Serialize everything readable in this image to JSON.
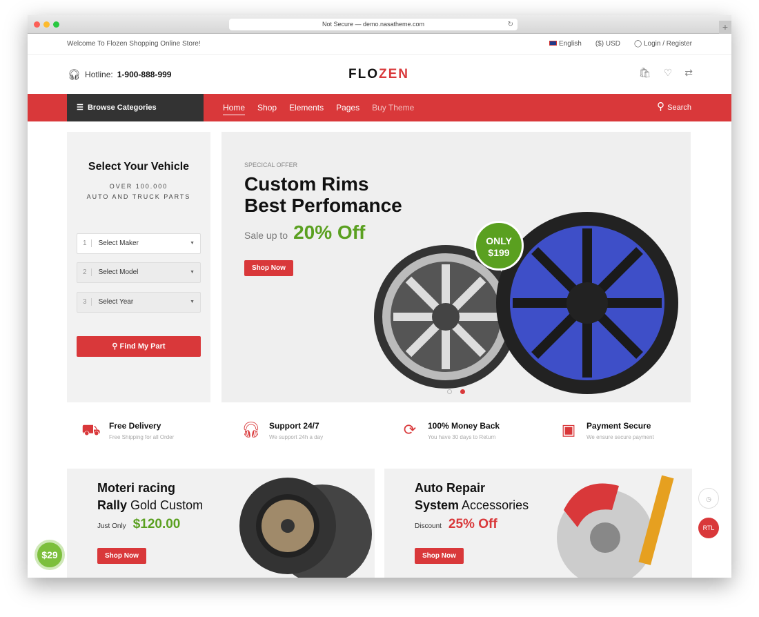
{
  "browser": {
    "url": "Not Secure — demo.nasatheme.com"
  },
  "topbar": {
    "welcome": "Welcome To Flozen Shopping Online Store!",
    "language": "English",
    "currency": "($) USD",
    "login": "Login / Register"
  },
  "header": {
    "hotline_label": "Hotline:",
    "hotline": "1-900-888-999",
    "logo_a": "FLO",
    "logo_b": "ZEN"
  },
  "nav": {
    "browse": "Browse Categories",
    "items": [
      "Home",
      "Shop",
      "Elements",
      "Pages",
      "Buy Theme"
    ],
    "search": "Search"
  },
  "vehicle": {
    "title": "Select Your Vehicle",
    "sub1": "OVER 100.000",
    "sub2": "AUTO AND TRUCK PARTS",
    "selects": [
      {
        "n": "1",
        "label": "Select Maker"
      },
      {
        "n": "2",
        "label": "Select Model"
      },
      {
        "n": "3",
        "label": "Select Year"
      }
    ],
    "button": "Find My Part"
  },
  "slider": {
    "tag": "SPECICAL OFFER",
    "title1": "Custom Rims",
    "title2": "Best Perfomance",
    "sale": "Sale up to",
    "off": "20% Off",
    "button": "Shop Now",
    "only": "ONLY",
    "price": "$199"
  },
  "features": [
    {
      "icon": "truck-icon",
      "title": "Free Delivery",
      "sub": "Free Shipping for all Order"
    },
    {
      "icon": "headset-icon",
      "title": "Support 24/7",
      "sub": "We support 24h a day"
    },
    {
      "icon": "refresh-icon",
      "title": "100% Money Back",
      "sub": "You have 30 days to Return"
    },
    {
      "icon": "payment-icon",
      "title": "Payment Secure",
      "sub": "We ensure secure payment"
    }
  ],
  "banners": [
    {
      "l1": "Moteri racing",
      "l2a": "Rally",
      "l2b": " Gold Custom",
      "label": "Just Only",
      "price": "$120.00",
      "button": "Shop Now",
      "color": "#5aa020"
    },
    {
      "l1": "Auto Repair",
      "l2a": "System",
      "l2b": " Accessories",
      "label": "Discount",
      "price": "25% Off",
      "button": "Shop Now",
      "color": "#d9383a"
    }
  ],
  "floating": {
    "rtl": "RTL",
    "badge": "$29"
  },
  "colors": {
    "accent": "#d9383a",
    "green": "#5aa020",
    "dark": "#333333"
  }
}
